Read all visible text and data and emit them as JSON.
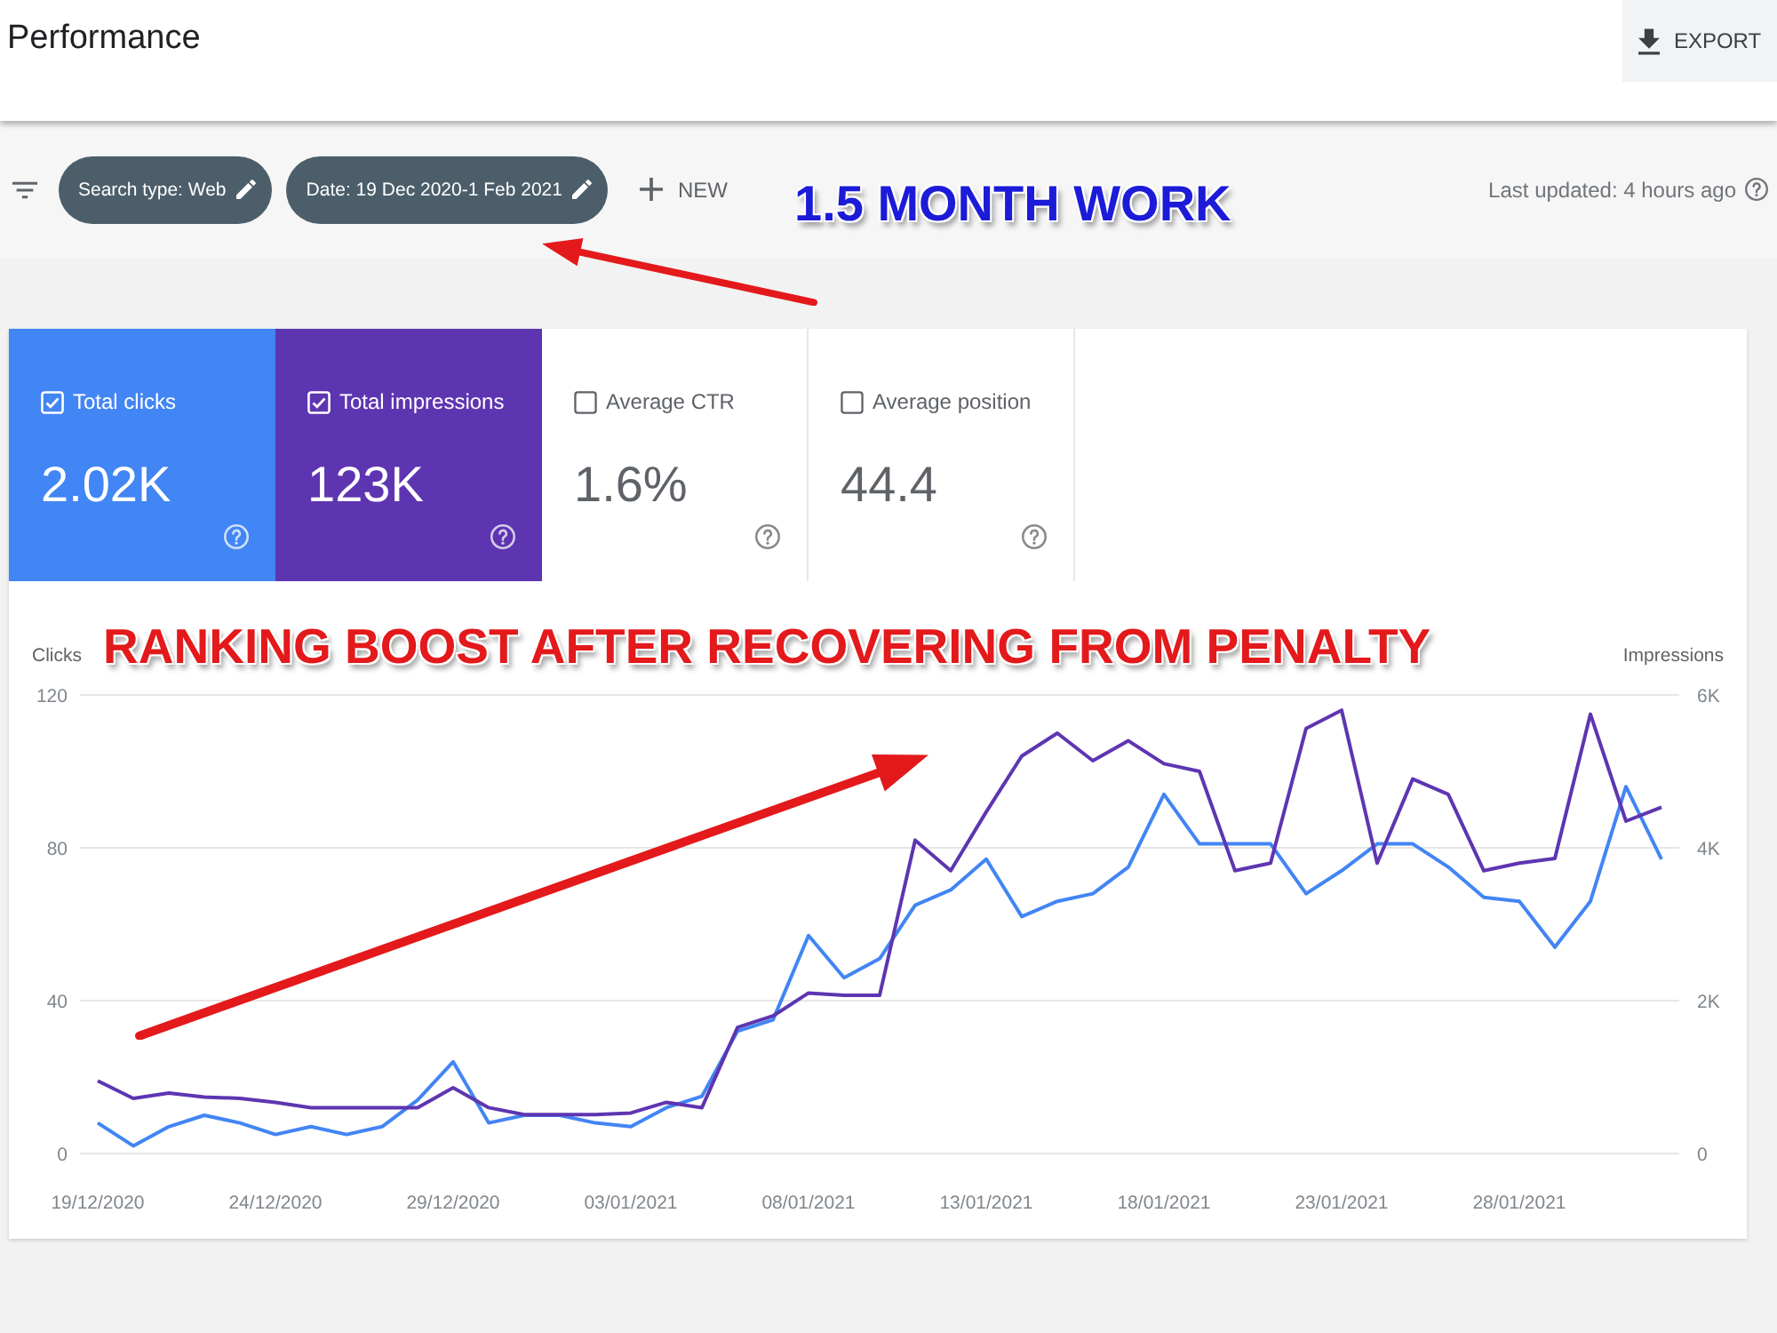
{
  "header": {
    "title": "Performance",
    "export_button": "EXPORT"
  },
  "filter_bar": {
    "chips": [
      {
        "label": "Search type: Web"
      },
      {
        "label": "Date: 19 Dec 2020-1 Feb 2021"
      }
    ],
    "new_button": "NEW",
    "last_updated": "Last updated: 4 hours ago"
  },
  "overlay": {
    "headline": "1.5 MONTH WORK",
    "caption": "RANKING BOOST AFTER RECOVERING FROM PENALTY"
  },
  "metrics": [
    {
      "label": "Total clicks",
      "value": "2.02K",
      "checked": true,
      "color": "#4285f4"
    },
    {
      "label": "Total impressions",
      "value": "123K",
      "checked": true,
      "color": "#5e35b1"
    },
    {
      "label": "Average CTR",
      "value": "1.6%",
      "checked": false
    },
    {
      "label": "Average position",
      "value": "44.4",
      "checked": false
    }
  ],
  "chart": {
    "chart_data": {
      "type": "line",
      "ylabel": "Clicks",
      "y2label": "Impressions",
      "grid": true,
      "x": [
        "2020-12-19",
        "2020-12-20",
        "2020-12-21",
        "2020-12-22",
        "2020-12-23",
        "2020-12-24",
        "2020-12-25",
        "2020-12-26",
        "2020-12-27",
        "2020-12-28",
        "2020-12-29",
        "2020-12-30",
        "2020-12-31",
        "2021-01-01",
        "2021-01-02",
        "2021-01-03",
        "2021-01-04",
        "2021-01-05",
        "2021-01-06",
        "2021-01-07",
        "2021-01-08",
        "2021-01-09",
        "2021-01-10",
        "2021-01-11",
        "2021-01-12",
        "2021-01-13",
        "2021-01-14",
        "2021-01-15",
        "2021-01-16",
        "2021-01-17",
        "2021-01-18",
        "2021-01-19",
        "2021-01-20",
        "2021-01-21",
        "2021-01-22",
        "2021-01-23",
        "2021-01-24",
        "2021-01-25",
        "2021-01-26",
        "2021-01-27",
        "2021-01-28",
        "2021-01-29",
        "2021-01-30",
        "2021-01-31",
        "2021-02-01"
      ],
      "xlim": [
        "2020-12-18T12:00",
        "2021-02-01T12:00"
      ],
      "xticks": [
        {
          "value": "2020-12-19",
          "label": "19/12/2020"
        },
        {
          "value": "2020-12-24",
          "label": "24/12/2020"
        },
        {
          "value": "2020-12-29",
          "label": "29/12/2020"
        },
        {
          "value": "2021-01-03",
          "label": "03/01/2021"
        },
        {
          "value": "2021-01-08",
          "label": "08/01/2021"
        },
        {
          "value": "2021-01-13",
          "label": "13/01/2021"
        },
        {
          "value": "2021-01-18",
          "label": "18/01/2021"
        },
        {
          "value": "2021-01-23",
          "label": "23/01/2021"
        },
        {
          "value": "2021-01-28",
          "label": "28/01/2021"
        }
      ],
      "ylim": [
        0,
        120
      ],
      "yticks": [
        0,
        40,
        80,
        120
      ],
      "y2lim": [
        0,
        6000
      ],
      "y2ticks": [
        {
          "value": 0,
          "label": "0"
        },
        {
          "value": 2000,
          "label": "2K"
        },
        {
          "value": 4000,
          "label": "4K"
        },
        {
          "value": 6000,
          "label": "6K"
        }
      ],
      "series": [
        {
          "color": "#4285f4",
          "values": [
            8,
            2,
            7,
            10,
            8,
            5,
            7,
            5,
            7,
            14,
            24,
            8,
            10,
            10,
            8,
            7,
            12,
            15,
            32,
            35,
            57,
            46,
            51,
            65,
            69,
            77,
            62,
            66,
            68,
            75,
            94,
            81,
            81,
            81,
            68,
            74,
            81,
            81,
            75,
            67,
            66,
            54,
            66,
            96,
            77
          ]
        },
        {
          "color": "#5e35b1",
          "axis": "y2",
          "values": [
            950,
            720,
            790,
            740,
            720,
            670,
            600,
            600,
            600,
            600,
            860,
            600,
            510,
            510,
            510,
            530,
            670,
            600,
            1650,
            1800,
            2100,
            2070,
            2070,
            4100,
            3700,
            4470,
            5200,
            5500,
            5140,
            5400,
            5100,
            5000,
            3700,
            3800,
            5560,
            5800,
            3800,
            4900,
            4700,
            3700,
            3800,
            3860,
            5750,
            4350,
            4530
          ]
        }
      ]
    }
  }
}
